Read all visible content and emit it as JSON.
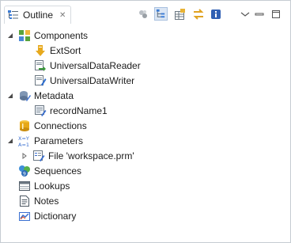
{
  "view": {
    "tab_title": "Outline",
    "tab_close_glyph": "✕",
    "tab_icon": "outline-icon"
  },
  "toolbar": {
    "items": [
      {
        "name": "filter-icon"
      },
      {
        "name": "hierarchy-icon"
      },
      {
        "name": "grid-icon"
      },
      {
        "name": "sync-icon"
      },
      {
        "name": "info-icon"
      },
      {
        "name": "view-menu-icon"
      },
      {
        "name": "minimize-icon"
      },
      {
        "name": "maximize-icon"
      }
    ]
  },
  "tree": {
    "components": {
      "label": "Components",
      "expanded": true
    },
    "extsort": {
      "label": "ExtSort"
    },
    "reader": {
      "label": "UniversalDataReader"
    },
    "writer": {
      "label": "UniversalDataWriter"
    },
    "metadata": {
      "label": "Metadata",
      "expanded": true
    },
    "record": {
      "label": "recordName1"
    },
    "connections": {
      "label": "Connections"
    },
    "parameters": {
      "label": "Parameters",
      "expanded": true
    },
    "file": {
      "label": "File 'workspace.prm'",
      "expanded": false
    },
    "sequences": {
      "label": "Sequences"
    },
    "lookups": {
      "label": "Lookups"
    },
    "notes": {
      "label": "Notes"
    },
    "dictionary": {
      "label": "Dictionary"
    }
  },
  "colors": {
    "border": "#c6ccd2",
    "accent": "#3a7bd5"
  }
}
